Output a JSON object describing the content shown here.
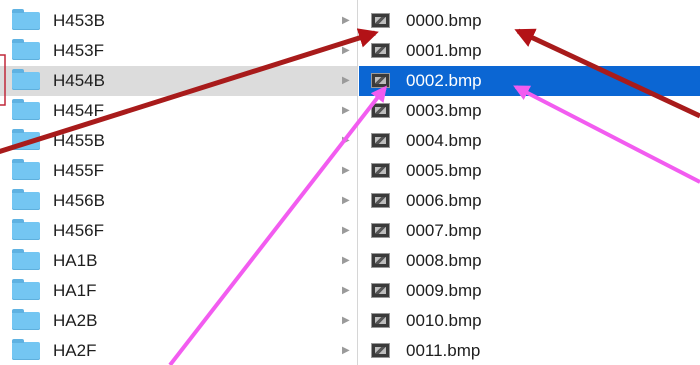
{
  "folders": [
    {
      "name": "H453B",
      "selected": false
    },
    {
      "name": "H453F",
      "selected": false
    },
    {
      "name": "H454B",
      "selected": true
    },
    {
      "name": "H454F",
      "selected": false
    },
    {
      "name": "H455B",
      "selected": false
    },
    {
      "name": "H455F",
      "selected": false
    },
    {
      "name": "H456B",
      "selected": false
    },
    {
      "name": "H456F",
      "selected": false
    },
    {
      "name": "HA1B",
      "selected": false
    },
    {
      "name": "HA1F",
      "selected": false
    },
    {
      "name": "HA2B",
      "selected": false
    },
    {
      "name": "HA2F",
      "selected": false
    }
  ],
  "folder_expand_glyph": "▶",
  "files": [
    {
      "name": "0000.bmp",
      "selected": false
    },
    {
      "name": "0001.bmp",
      "selected": false
    },
    {
      "name": "0002.bmp",
      "selected": true
    },
    {
      "name": "0003.bmp",
      "selected": false
    },
    {
      "name": "0004.bmp",
      "selected": false
    },
    {
      "name": "0005.bmp",
      "selected": false
    },
    {
      "name": "0006.bmp",
      "selected": false
    },
    {
      "name": "0007.bmp",
      "selected": false
    },
    {
      "name": "0008.bmp",
      "selected": false
    },
    {
      "name": "0009.bmp",
      "selected": false
    },
    {
      "name": "0010.bmp",
      "selected": false
    },
    {
      "name": "0011.bmp",
      "selected": false
    }
  ],
  "icons": {
    "folder": "folder-icon",
    "file": "bmp-image-file-icon",
    "expand": "chevron-right-icon"
  },
  "colors": {
    "folder_selected_bg": "#dcdcdc",
    "file_selected_bg": "#0b66d3",
    "annotation_red": "#b31217",
    "annotation_pink": "#f25cf0"
  }
}
